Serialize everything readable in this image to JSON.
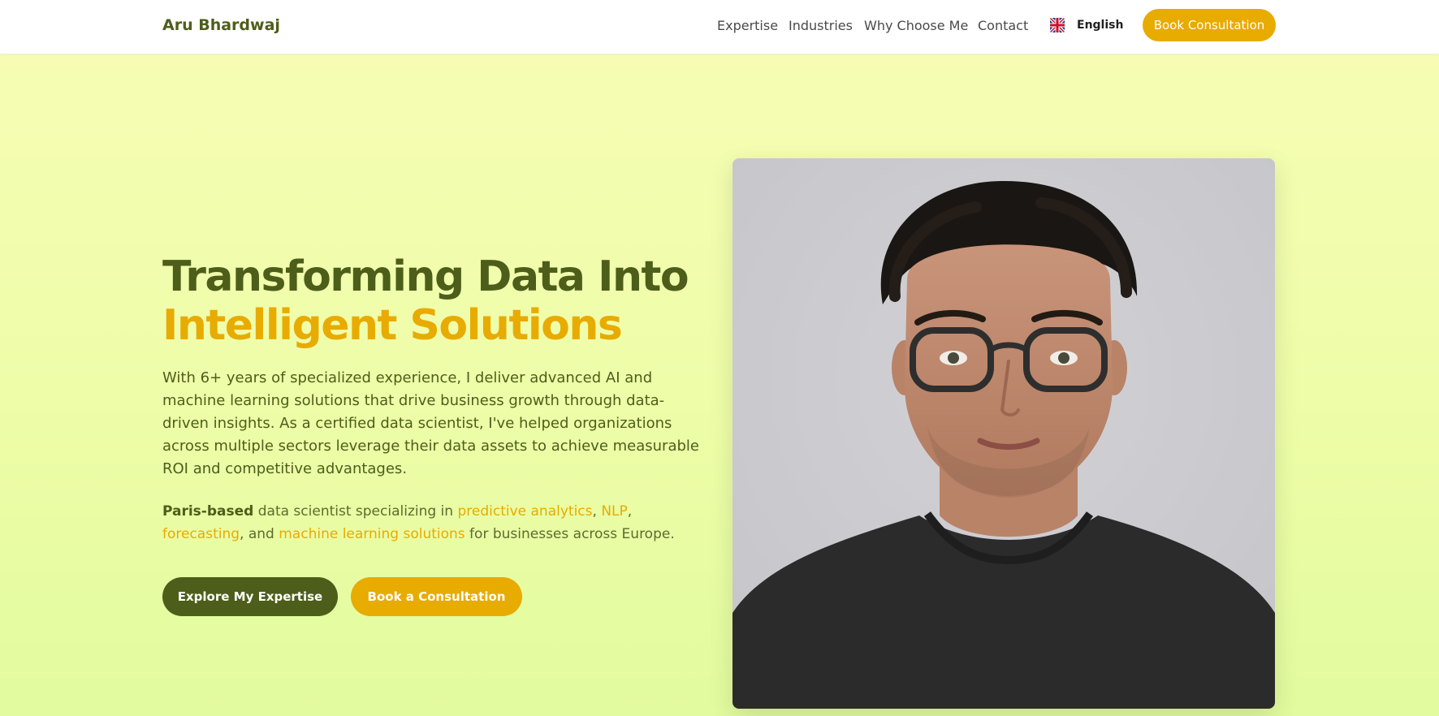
{
  "nav": {
    "brand": "Aru Bhardwaj",
    "links": [
      {
        "label": "Expertise"
      },
      {
        "label": "Industries"
      },
      {
        "label": "Why Choose Me"
      },
      {
        "label": "Contact"
      }
    ],
    "language": {
      "label": "English",
      "icon": "uk-flag-icon"
    },
    "cta_label": "Book Consultation"
  },
  "hero": {
    "title_line1": "Transforming Data Into",
    "title_line2": "Intelligent Solutions",
    "description": "With 6+ years of specialized experience, I deliver advanced AI and machine learning solutions that drive business growth through data-driven insights. As a certified data scientist, I've helped organizations across multiple sectors leverage their data assets to achieve measurable ROI and competitive advantages.",
    "sub": {
      "location": "Paris-based",
      "text1": " data scientist specializing in ",
      "skill1": "predictive analytics",
      "sep1": ", ",
      "skill2": "NLP",
      "sep2": ", ",
      "skill3": "forecasting",
      "sep3": ", and ",
      "skill4": "machine learning solutions",
      "text2": " for businesses across Europe."
    },
    "primary_button": "Explore My Expertise",
    "secondary_button": "Book a Consultation"
  },
  "colors": {
    "brand_green": "#4d5e1a",
    "accent_gold": "#e8ab00",
    "background": "#f3fdb0"
  }
}
